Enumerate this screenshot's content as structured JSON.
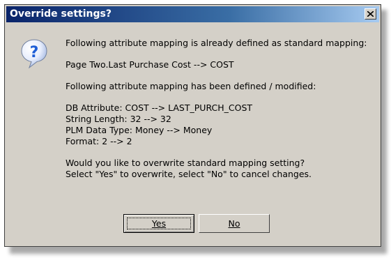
{
  "dialog": {
    "title": "Override settings?",
    "icon": "question-icon",
    "lines": [
      "Following attribute mapping is already defined as standard mapping:",
      "Page Two.Last Purchase Cost --> COST",
      "Following attribute mapping has been defined / modified:",
      "DB Attribute: COST --> LAST_PURCH_COST",
      "String Length: 32 --> 32",
      "PLM Data Type: Money --> Money",
      "Format: 2 --> 2",
      "Would you like to overwrite standard mapping setting?",
      "Select \"Yes\" to overwrite, select \"No\" to cancel changes."
    ],
    "buttons": {
      "yes_label": "Yes",
      "no_label": "No"
    }
  },
  "colors": {
    "title_gradient_start": "#0a246a",
    "title_gradient_end": "#a6caf0",
    "face": "#d4d0c8",
    "icon_blue": "#1f5fd6"
  }
}
